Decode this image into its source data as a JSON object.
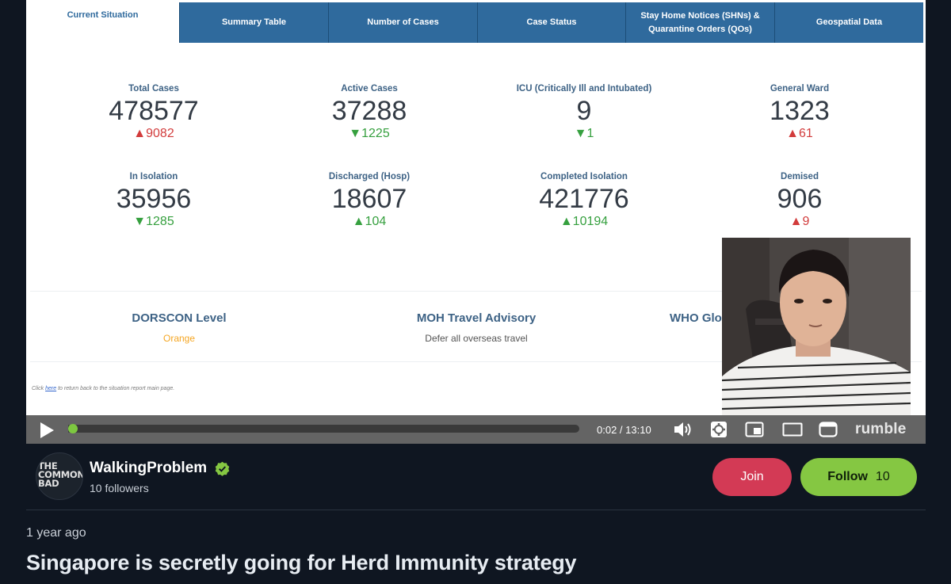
{
  "dashboard": {
    "tabs": [
      {
        "label": "Current Situation"
      },
      {
        "label": "Summary Table"
      },
      {
        "label": "Number of Cases"
      },
      {
        "label": "Case Status"
      },
      {
        "label": "Stay Home Notices (SHNs) & Quarantine Orders (QOs)"
      },
      {
        "label": "Geospatial Data"
      }
    ],
    "metrics": [
      {
        "label": "Total Cases",
        "value": "478577",
        "delta": "9082",
        "arrow": "▲",
        "trend": "up-bad"
      },
      {
        "label": "Active Cases",
        "value": "37288",
        "delta": "1225",
        "arrow": "▼",
        "trend": "down-good"
      },
      {
        "label": "ICU (Critically Ill and Intubated)",
        "value": "9",
        "delta": "1",
        "arrow": "▼",
        "trend": "down-good"
      },
      {
        "label": "General Ward",
        "value": "1323",
        "delta": "61",
        "arrow": "▲",
        "trend": "up-bad"
      },
      {
        "label": "In Isolation",
        "value": "35956",
        "delta": "1285",
        "arrow": "▼",
        "trend": "down-good"
      },
      {
        "label": "Discharged (Hosp)",
        "value": "18607",
        "delta": "104",
        "arrow": "▲",
        "trend": "up-good"
      },
      {
        "label": "Completed Isolation",
        "value": "421776",
        "delta": "10194",
        "arrow": "▲",
        "trend": "up-good"
      },
      {
        "label": "Demised",
        "value": "906",
        "delta": "9",
        "arrow": "▲",
        "trend": "up-bad"
      }
    ],
    "info": {
      "dorscon_title": "DORSCON Level",
      "dorscon_value": "Orange",
      "travel_title": "MOH Travel Advisory",
      "travel_value": "Defer all overseas travel",
      "who_title": "WHO Glo"
    },
    "footnote_prefix": "Click ",
    "footnote_link": "here",
    "footnote_suffix": " to return back to the situation report main page.",
    "colors": {
      "tab_bg": "#2f6a9d",
      "up_bad": "#d23c3c",
      "down_good": "#36a03f",
      "orange": "#f5a623"
    }
  },
  "player": {
    "time": "0:02 / 13:10",
    "brand": "rumble",
    "progress_fraction": 0.0025,
    "icons": [
      "play-icon",
      "volume-icon",
      "settings-icon",
      "pip-icon",
      "theater-icon",
      "fullscreen-icon"
    ]
  },
  "channel": {
    "avatar_text": "THE COMMON BAD",
    "name": "WalkingProblem",
    "followers": "10 followers",
    "join_label": "Join",
    "follow_label": "Follow",
    "follow_count": "10"
  },
  "video": {
    "posted": "1 year ago",
    "title": "Singapore is secretly going for Herd Immunity strategy"
  }
}
